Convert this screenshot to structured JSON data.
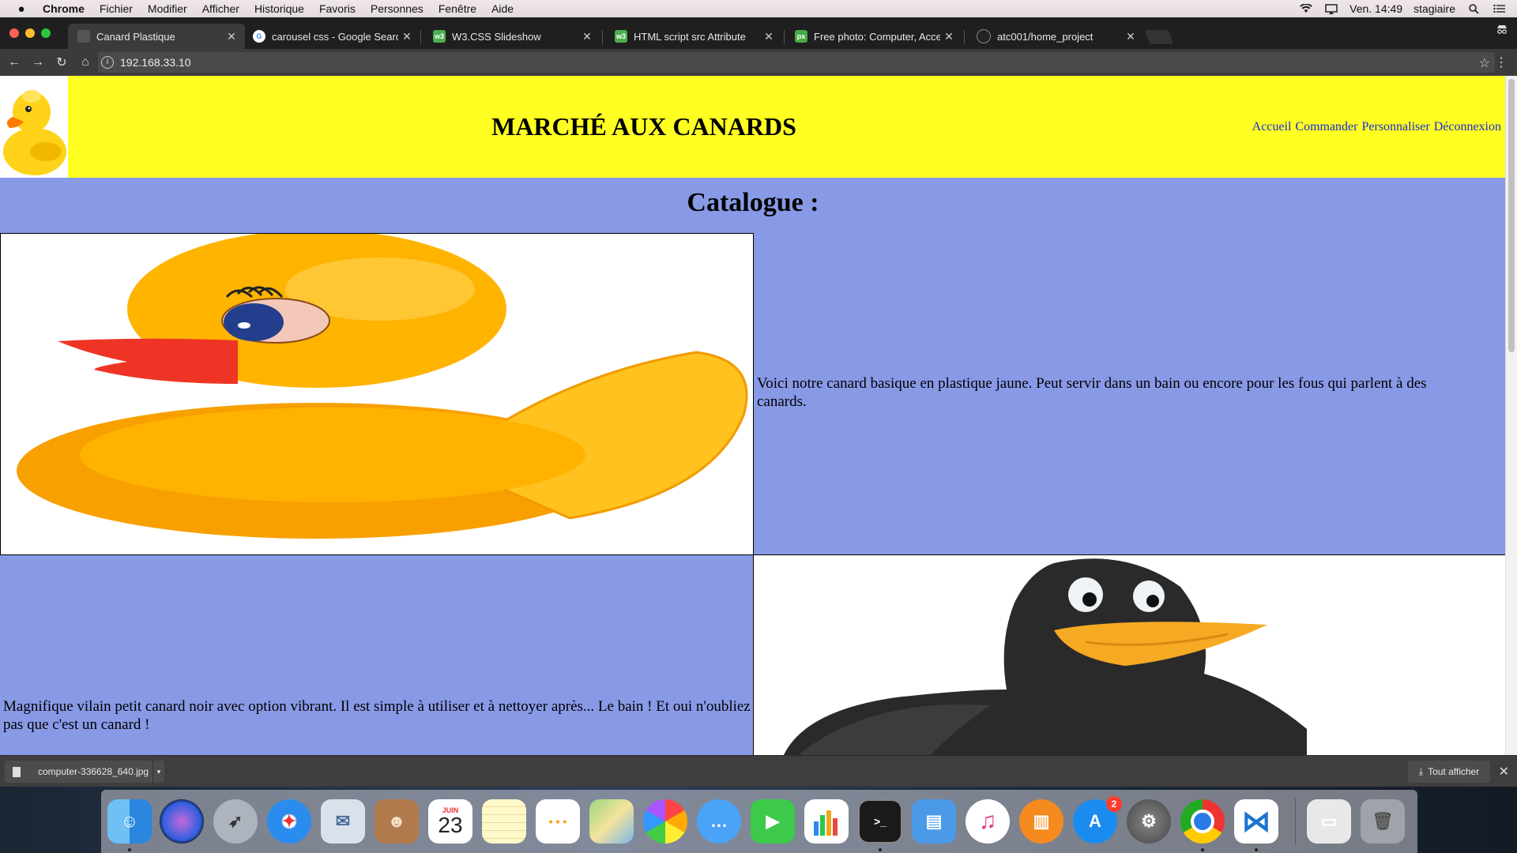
{
  "menubar": {
    "app_name": "Chrome",
    "items": [
      "Fichier",
      "Modifier",
      "Afficher",
      "Historique",
      "Favoris",
      "Personnes",
      "Fenêtre",
      "Aide"
    ],
    "clock": "Ven. 14:49",
    "user": "stagiaire"
  },
  "tabs": [
    {
      "title": "Canard Plastique",
      "icon": "page-icon",
      "active": true
    },
    {
      "title": "carousel css - Google Search",
      "icon": "google-icon",
      "active": false
    },
    {
      "title": "W3.CSS Slideshow",
      "icon": "w3schools-icon",
      "active": false
    },
    {
      "title": "HTML script src Attribute",
      "icon": "w3schools-icon",
      "active": false
    },
    {
      "title": "Free photo: Computer, Access",
      "icon": "pixabay-icon",
      "active": false
    },
    {
      "title": "atc001/home_project",
      "icon": "github-icon",
      "active": false
    }
  ],
  "omnibox": {
    "url": "192.168.33.10"
  },
  "page": {
    "site_title": "MARCHÉ AUX CANARDS",
    "nav": [
      "Accueil",
      "Commander",
      "Personnaliser",
      "Déconnexion"
    ],
    "catalogue_title": "Catalogue :",
    "products": [
      {
        "image": "yellow-rubber-duck",
        "description": "Voici notre canard basique en plastique jaune. Peut servir dans un bain ou encore pour les fous qui parlent à des canards."
      },
      {
        "image": "black-rubber-duck",
        "description": "Magnifique vilain petit canard noir avec option vibrant. Il est simple à utiliser et à nettoyer après... Le bain ! Et oui n'oubliez pas que c'est un canard !"
      }
    ]
  },
  "downloads": {
    "file_name": "computer-336628_640.jpg",
    "show_all": "Tout afficher"
  },
  "dock": {
    "calendar_month": "JUIN",
    "calendar_day": "23",
    "app_store_badge": "2",
    "apps": [
      "finder",
      "siri",
      "launchpad",
      "safari",
      "mail",
      "contacts",
      "calendar",
      "notes",
      "reminders",
      "maps",
      "photos",
      "messages",
      "facetime",
      "numbers",
      "terminal",
      "keynote",
      "itunes",
      "ibooks",
      "app-store",
      "system-preferences",
      "chrome",
      "vscode",
      "downloads-stack",
      "trash"
    ]
  },
  "colors": {
    "header_yellow": "#ffff22",
    "page_background": "#8899e6",
    "nav_link": "#1a2bd8"
  }
}
